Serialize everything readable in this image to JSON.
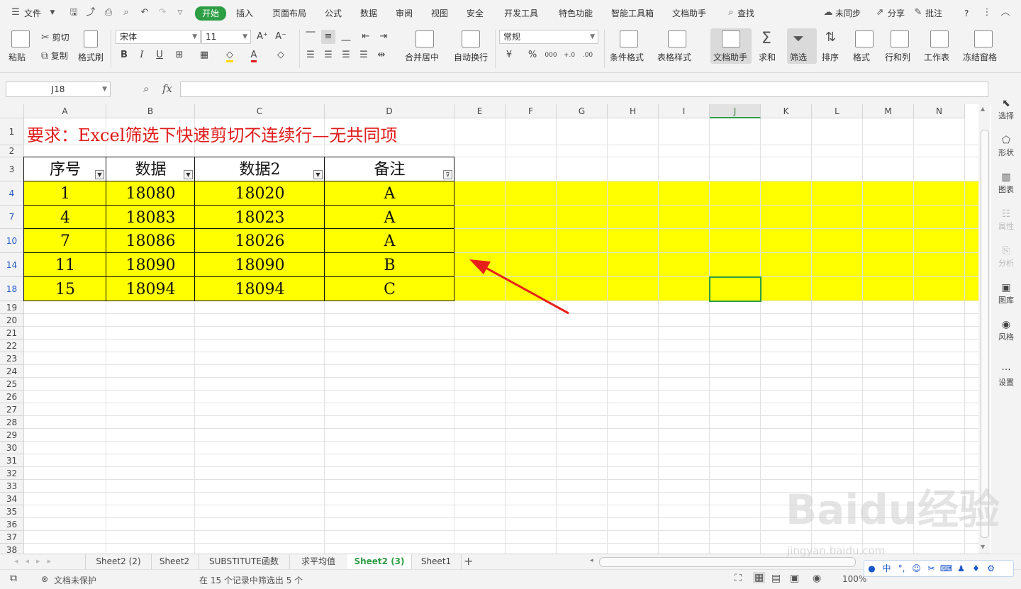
{
  "menubar": {
    "file": "文件",
    "tabs": [
      "开始",
      "插入",
      "页面布局",
      "公式",
      "数据",
      "审阅",
      "视图",
      "安全",
      "开发工具",
      "特色功能",
      "智能工具箱",
      "文档助手"
    ],
    "search": "查找",
    "sync": "未同步",
    "share": "分享",
    "comment": "批注",
    "help": "?"
  },
  "ribbon": {
    "paste": "粘贴",
    "cut": "剪切",
    "copy": "复制",
    "format_painter": "格式刷",
    "font_name": "宋体",
    "font_size": "11",
    "bold": "B",
    "italic": "I",
    "underline": "U",
    "merge": "合并居中",
    "wrap": "自动换行",
    "number_format": "常规",
    "percent": "%",
    "cond_format": "条件格式",
    "table_style": "表格样式",
    "doc_helper": "文档助手",
    "sum": "求和",
    "filter": "筛选",
    "sort": "排序",
    "format": "格式",
    "rowcol": "行和列",
    "worksheet": "工作表",
    "freeze": "冻结窗格"
  },
  "formula": {
    "name_box": "J18",
    "fx": "fx",
    "content": ""
  },
  "sidebar": [
    "选择",
    "形状",
    "图表",
    "属性",
    "分析",
    "图库",
    "风格",
    "设置"
  ],
  "columns": [
    "A",
    "B",
    "C",
    "D",
    "E",
    "F",
    "G",
    "H",
    "I",
    "J",
    "K",
    "L",
    "M",
    "N"
  ],
  "rows": [
    "1",
    "2",
    "3",
    "4",
    "7",
    "10",
    "14",
    "18",
    "19",
    "20",
    "21",
    "22",
    "23",
    "24",
    "25",
    "26",
    "27",
    "28",
    "29",
    "30",
    "31",
    "32",
    "33",
    "34",
    "35",
    "36",
    "37",
    "38"
  ],
  "sheet": {
    "title": "要求：Excel筛选下快速剪切不连续行—无共同项",
    "headers": [
      "序号",
      "数据",
      "数据2",
      "备注"
    ],
    "data": [
      [
        "1",
        "18080",
        "18020",
        "A"
      ],
      [
        "4",
        "18083",
        "18023",
        "A"
      ],
      [
        "7",
        "18086",
        "18026",
        "A"
      ],
      [
        "11",
        "18090",
        "18090",
        "B"
      ],
      [
        "15",
        "18094",
        "18094",
        "C"
      ]
    ]
  },
  "sheet_tabs": [
    "Sheet2 (2)",
    "Sheet2",
    "SUBSTITUTE函数",
    "求平均值",
    "Sheet2 (3)",
    "Sheet1"
  ],
  "active_sheet": "Sheet2 (3)",
  "status": {
    "protect": "文档未保护",
    "filter_info": "在 15 个记录中筛选出 5 个",
    "zoom": "100%"
  },
  "ime": [
    "中"
  ],
  "watermark": {
    "main": "Baidu经验",
    "sub": "jingyan.baidu.com"
  },
  "colors": {
    "accent": "#2e9e45",
    "highlight": "#ffff00",
    "title": "#e01a1a",
    "arrow": "#e8201a"
  }
}
